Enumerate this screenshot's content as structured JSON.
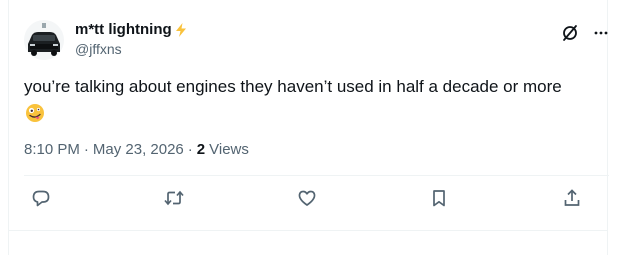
{
  "author": {
    "display_name": "m*tt lightning",
    "handle": "@jffxns",
    "avatar_icon": "pickup-truck-avatar",
    "badge_icon": "lightning-bolt-icon",
    "badge_color": "#f9c23c"
  },
  "tweet": {
    "text": "you’re talking about engines they haven’t used in half a decade or more",
    "emoji_icon": "zany-face-emoji"
  },
  "meta": {
    "time": "8:10 PM",
    "separator": "·",
    "date": "May 23, 2026",
    "views_count": "2",
    "views_label": "Views"
  },
  "actions": {
    "icons": [
      "reply-icon",
      "retweet-icon",
      "like-icon",
      "bookmark-icon",
      "share-icon"
    ]
  },
  "colors": {
    "text_primary": "#0f1419",
    "text_secondary": "#536471",
    "icon": "#536471",
    "divider": "#eff3f4"
  }
}
